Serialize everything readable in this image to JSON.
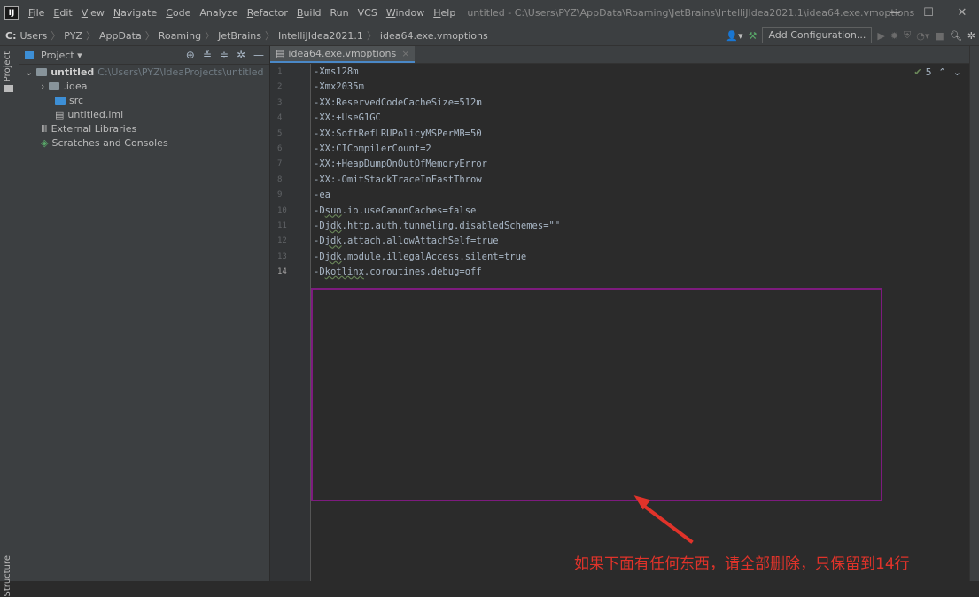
{
  "app_icon": "IJ",
  "menu": [
    {
      "key": "F",
      "rest": "ile"
    },
    {
      "key": "E",
      "rest": "dit"
    },
    {
      "key": "V",
      "rest": "iew"
    },
    {
      "key": "N",
      "rest": "avigate"
    },
    {
      "key": "C",
      "rest": "ode"
    },
    {
      "key": "",
      "rest": "Analyze"
    },
    {
      "key": "R",
      "rest": "efactor"
    },
    {
      "key": "B",
      "rest": "uild"
    },
    {
      "key": "",
      "rest": "Run"
    },
    {
      "key": "",
      "rest": "VCS"
    },
    {
      "key": "W",
      "rest": "indow"
    },
    {
      "key": "H",
      "rest": "elp"
    }
  ],
  "window_title": "untitled - C:\\Users\\PYZ\\AppData\\Roaming\\JetBrains\\IntelliJIdea2021.1\\idea64.exe.vmoptions",
  "breadcrumbs": [
    "C:",
    "Users",
    "PYZ",
    "AppData",
    "Roaming",
    "JetBrains",
    "IntelliJIdea2021.1",
    "idea64.exe.vmoptions"
  ],
  "run_config": "Add Configuration...",
  "project_panel": {
    "title": "Project ▾",
    "root": {
      "name": "untitled",
      "path": "C:\\Users\\PYZ\\IdeaProjects\\untitled"
    },
    "items": [
      ".idea",
      "src",
      "untitled.iml",
      "External Libraries",
      "Scratches and Consoles"
    ]
  },
  "left_tabs": {
    "project": "Project",
    "structure": "Structure"
  },
  "editor": {
    "tab": "idea64.exe.vmoptions",
    "inspection_count": "5",
    "current_line": "14",
    "lines": [
      "-Xms128m",
      "-Xmx2035m",
      "-XX:ReservedCodeCacheSize=512m",
      "-XX:+UseG1GC",
      "-XX:SoftRefLRUPolicyMSPerMB=50",
      "-XX:CICompilerCount=2",
      "-XX:+HeapDumpOnOutOfMemoryError",
      "-XX:-OmitStackTraceInFastThrow",
      "-ea",
      "-Dsun.io.useCanonCaches=false",
      "-Djdk.http.auth.tunneling.disabledSchemes=\"\"",
      "-Djdk.attach.allowAttachSelf=true",
      "-Djdk.module.illegalAccess.silent=true",
      "-Dkotlinx.coroutines.debug=off"
    ]
  },
  "annotation_text": "如果下面有任何东西，请全部删除，只保留到14行",
  "colors": {
    "annotation_red": "#e0332a",
    "box_purple": "#7d1b7e"
  }
}
